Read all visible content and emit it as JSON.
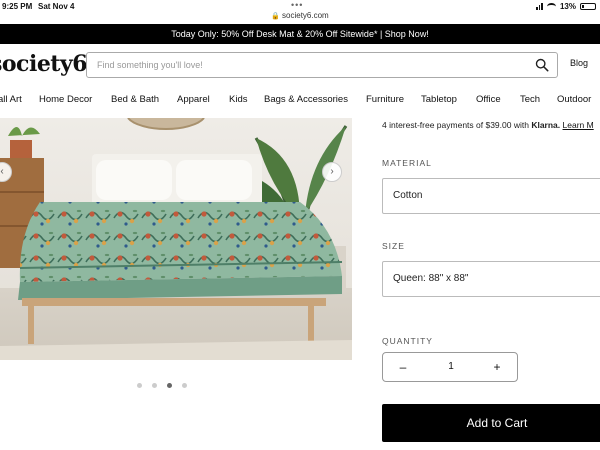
{
  "status_bar": {
    "time": "9:25 PM",
    "date": "Sat Nov 4",
    "multitask_dots": "•••",
    "lock_icon": "lock-icon",
    "url": "society6.com",
    "battery": "13%"
  },
  "promo": {
    "text": "Today Only: 50% Off Desk Mat & 20% Off Sitewide* | Shop Now!"
  },
  "header": {
    "logo": "society6",
    "search_placeholder": "Find something you'll love!",
    "search_icon": "search-icon",
    "blog_label": "Blog"
  },
  "nav": {
    "items": [
      "all Art",
      "Home Decor",
      "Bed & Bath",
      "Apparel",
      "Kids",
      "Bags & Accessories",
      "Furniture",
      "Tabletop",
      "Office",
      "Tech",
      "Outdoor"
    ]
  },
  "gallery": {
    "prev_arrow": "‹",
    "next_arrow": "›",
    "slide_count": 4,
    "active_slide": 3
  },
  "product": {
    "installments": {
      "prefix": "4 interest-free payments of $39.00 with ",
      "provider": "Klarna.",
      "link": "Learn M"
    },
    "material_label": "MATERIAL",
    "material_value": "Cotton",
    "size_label": "SIZE",
    "size_value": "Queen: 88\" x 88\"",
    "quantity_label": "QUANTITY",
    "quantity_value": "1",
    "minus": "–",
    "plus": "+",
    "cart_button": "Add to Cart"
  },
  "colors": {
    "promo_bg": "#000000",
    "cart_bg": "#000000",
    "duvet": "#8fb8a0"
  }
}
